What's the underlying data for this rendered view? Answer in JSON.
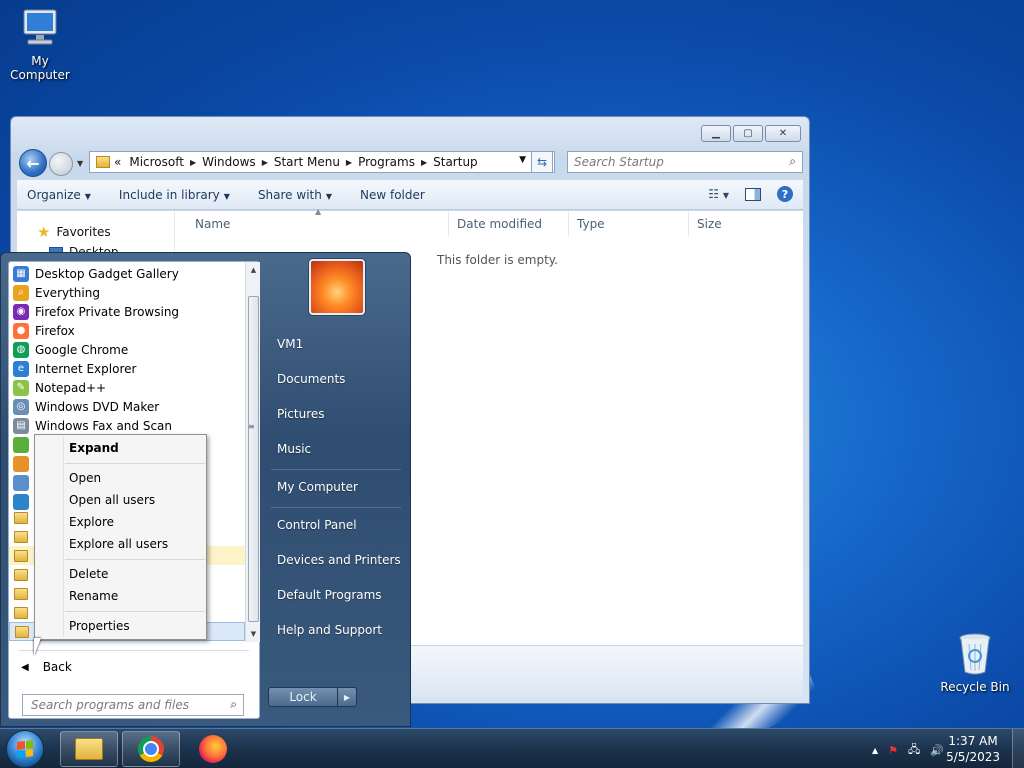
{
  "desktop": {
    "icons": [
      {
        "label": "My Computer"
      },
      {
        "label": "Recycle Bin"
      }
    ]
  },
  "explorer": {
    "breadcrumb": [
      "Microsoft",
      "Windows",
      "Start Menu",
      "Programs",
      "Startup"
    ],
    "breadcrumb_prefix": "«",
    "search_placeholder": "Search Startup",
    "toolbar": {
      "organize": "Organize",
      "include_in_library": "Include in library",
      "share_with": "Share with",
      "new_folder": "New folder"
    },
    "nav": {
      "favorites": "Favorites",
      "desktop": "Desktop"
    },
    "columns": [
      "Name",
      "Date modified",
      "Type",
      "Size"
    ],
    "empty_message": "This folder is empty."
  },
  "start_menu": {
    "programs": [
      {
        "label": "Desktop Gadget Gallery",
        "icon": "gadget-icon",
        "color": "#3a7bd5"
      },
      {
        "label": "Everything",
        "icon": "search-icon",
        "color": "#e8a320"
      },
      {
        "label": "Firefox Private Browsing",
        "icon": "mask-icon",
        "color": "#7b2ab8"
      },
      {
        "label": "Firefox",
        "icon": "firefox-icon",
        "color": "#ff7139"
      },
      {
        "label": "Google Chrome",
        "icon": "chrome-icon",
        "color": "#0f9d58"
      },
      {
        "label": "Internet Explorer",
        "icon": "ie-icon",
        "color": "#2b7fd4"
      },
      {
        "label": "Notepad++",
        "icon": "notepad-icon",
        "color": "#8bc34a"
      },
      {
        "label": "Windows DVD Maker",
        "icon": "dvd-icon",
        "color": "#6a8fb5"
      },
      {
        "label": "Windows Fax and Scan",
        "icon": "fax-icon",
        "color": "#7d8c9c"
      }
    ],
    "back_label": "Back",
    "search_placeholder": "Search programs and files",
    "right_items": [
      "VM1",
      "Documents",
      "Pictures",
      "Music",
      "My Computer",
      "Control Panel",
      "Devices and Printers",
      "Default Programs",
      "Help and Support"
    ],
    "lock_label": "Lock"
  },
  "context_menu": {
    "expand": "Expand",
    "open": "Open",
    "open_all_users": "Open all users",
    "explore": "Explore",
    "explore_all_users": "Explore all users",
    "delete": "Delete",
    "rename": "Rename",
    "properties": "Properties"
  },
  "taskbar": {
    "time": "1:37 AM",
    "date": "5/5/2023"
  }
}
